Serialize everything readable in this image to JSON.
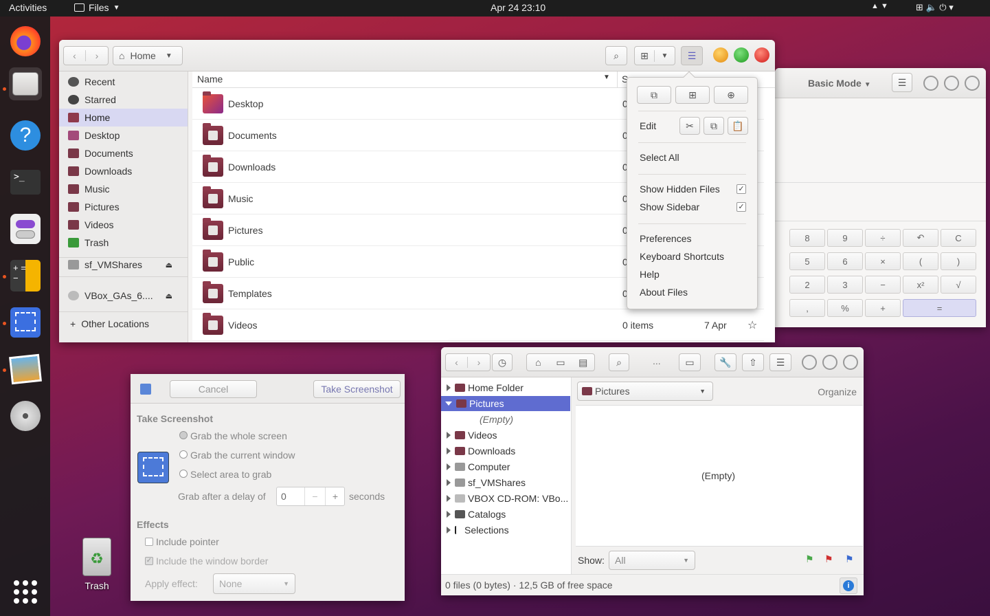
{
  "topbar": {
    "activities": "Activities",
    "app": "Files",
    "clock": "Apr 24  23:10"
  },
  "dock": {
    "items": [
      "firefox-icon",
      "files-icon",
      "help-icon",
      "terminal-icon",
      "settings-icon",
      "calculator-icon",
      "screenshot-icon",
      "shotwell-icon",
      "cdrom-icon"
    ],
    "apps_grid": "apps-grid-icon"
  },
  "desktop": {
    "trash_label": "Trash"
  },
  "files": {
    "location": "Home",
    "sidebar": [
      "Recent",
      "Starred",
      "Home",
      "Desktop",
      "Documents",
      "Downloads",
      "Music",
      "Pictures",
      "Videos",
      "Trash"
    ],
    "devices": [
      "sf_VMShares",
      "VBox_GAs_6...."
    ],
    "other": "Other Locations",
    "col_name": "Name",
    "col_size": "S",
    "rows": [
      {
        "name": "Desktop",
        "size": "0"
      },
      {
        "name": "Documents",
        "size": "0"
      },
      {
        "name": "Downloads",
        "size": "0"
      },
      {
        "name": "Music",
        "size": "0"
      },
      {
        "name": "Pictures",
        "size": "0"
      },
      {
        "name": "Public",
        "size": "0"
      },
      {
        "name": "Templates",
        "size": "0"
      },
      {
        "name": "Videos",
        "size": "0 items",
        "date": "7 Apr",
        "star": "☆"
      }
    ]
  },
  "menu": {
    "edit": "Edit",
    "select_all": "Select All",
    "show_hidden": "Show Hidden Files",
    "show_sidebar": "Show Sidebar",
    "preferences": "Preferences",
    "shortcuts": "Keyboard Shortcuts",
    "help": "Help",
    "about": "About Files"
  },
  "calc": {
    "mode": "Basic Mode",
    "keys": [
      "8",
      "9",
      "÷",
      "↶",
      "C",
      "5",
      "6",
      "×",
      "(",
      ")",
      "2",
      "3",
      "−",
      "x²",
      "√",
      ",",
      "%",
      "+",
      "="
    ]
  },
  "screenshot": {
    "cancel": "Cancel",
    "take": "Take Screenshot",
    "heading": "Take Screenshot",
    "opt_whole": "Grab the whole screen",
    "opt_window": "Grab the current window",
    "opt_area": "Select area to grab",
    "delay_label": "Grab after a delay of",
    "delay_value": "0",
    "seconds": "seconds",
    "effects": "Effects",
    "pointer": "Include pointer",
    "border": "Include the window border",
    "apply": "Apply effect:",
    "effect_value": "None"
  },
  "shotwell": {
    "tree": [
      {
        "label": "Home Folder"
      },
      {
        "label": "Pictures",
        "selected": true
      },
      {
        "label": "(Empty)",
        "child": true
      },
      {
        "label": "Videos"
      },
      {
        "label": "Downloads"
      },
      {
        "label": "Computer"
      },
      {
        "label": "sf_VMShares"
      },
      {
        "label": "VBOX CD-ROM: VBo..."
      },
      {
        "label": "Catalogs"
      },
      {
        "label": "Selections"
      }
    ],
    "folder": "Pictures",
    "organize": "Organize",
    "empty": "(Empty)",
    "show": "Show:",
    "show_value": "All",
    "status": "0 files (0 bytes)  ·  12,5 GB of free space",
    "more": "..."
  }
}
